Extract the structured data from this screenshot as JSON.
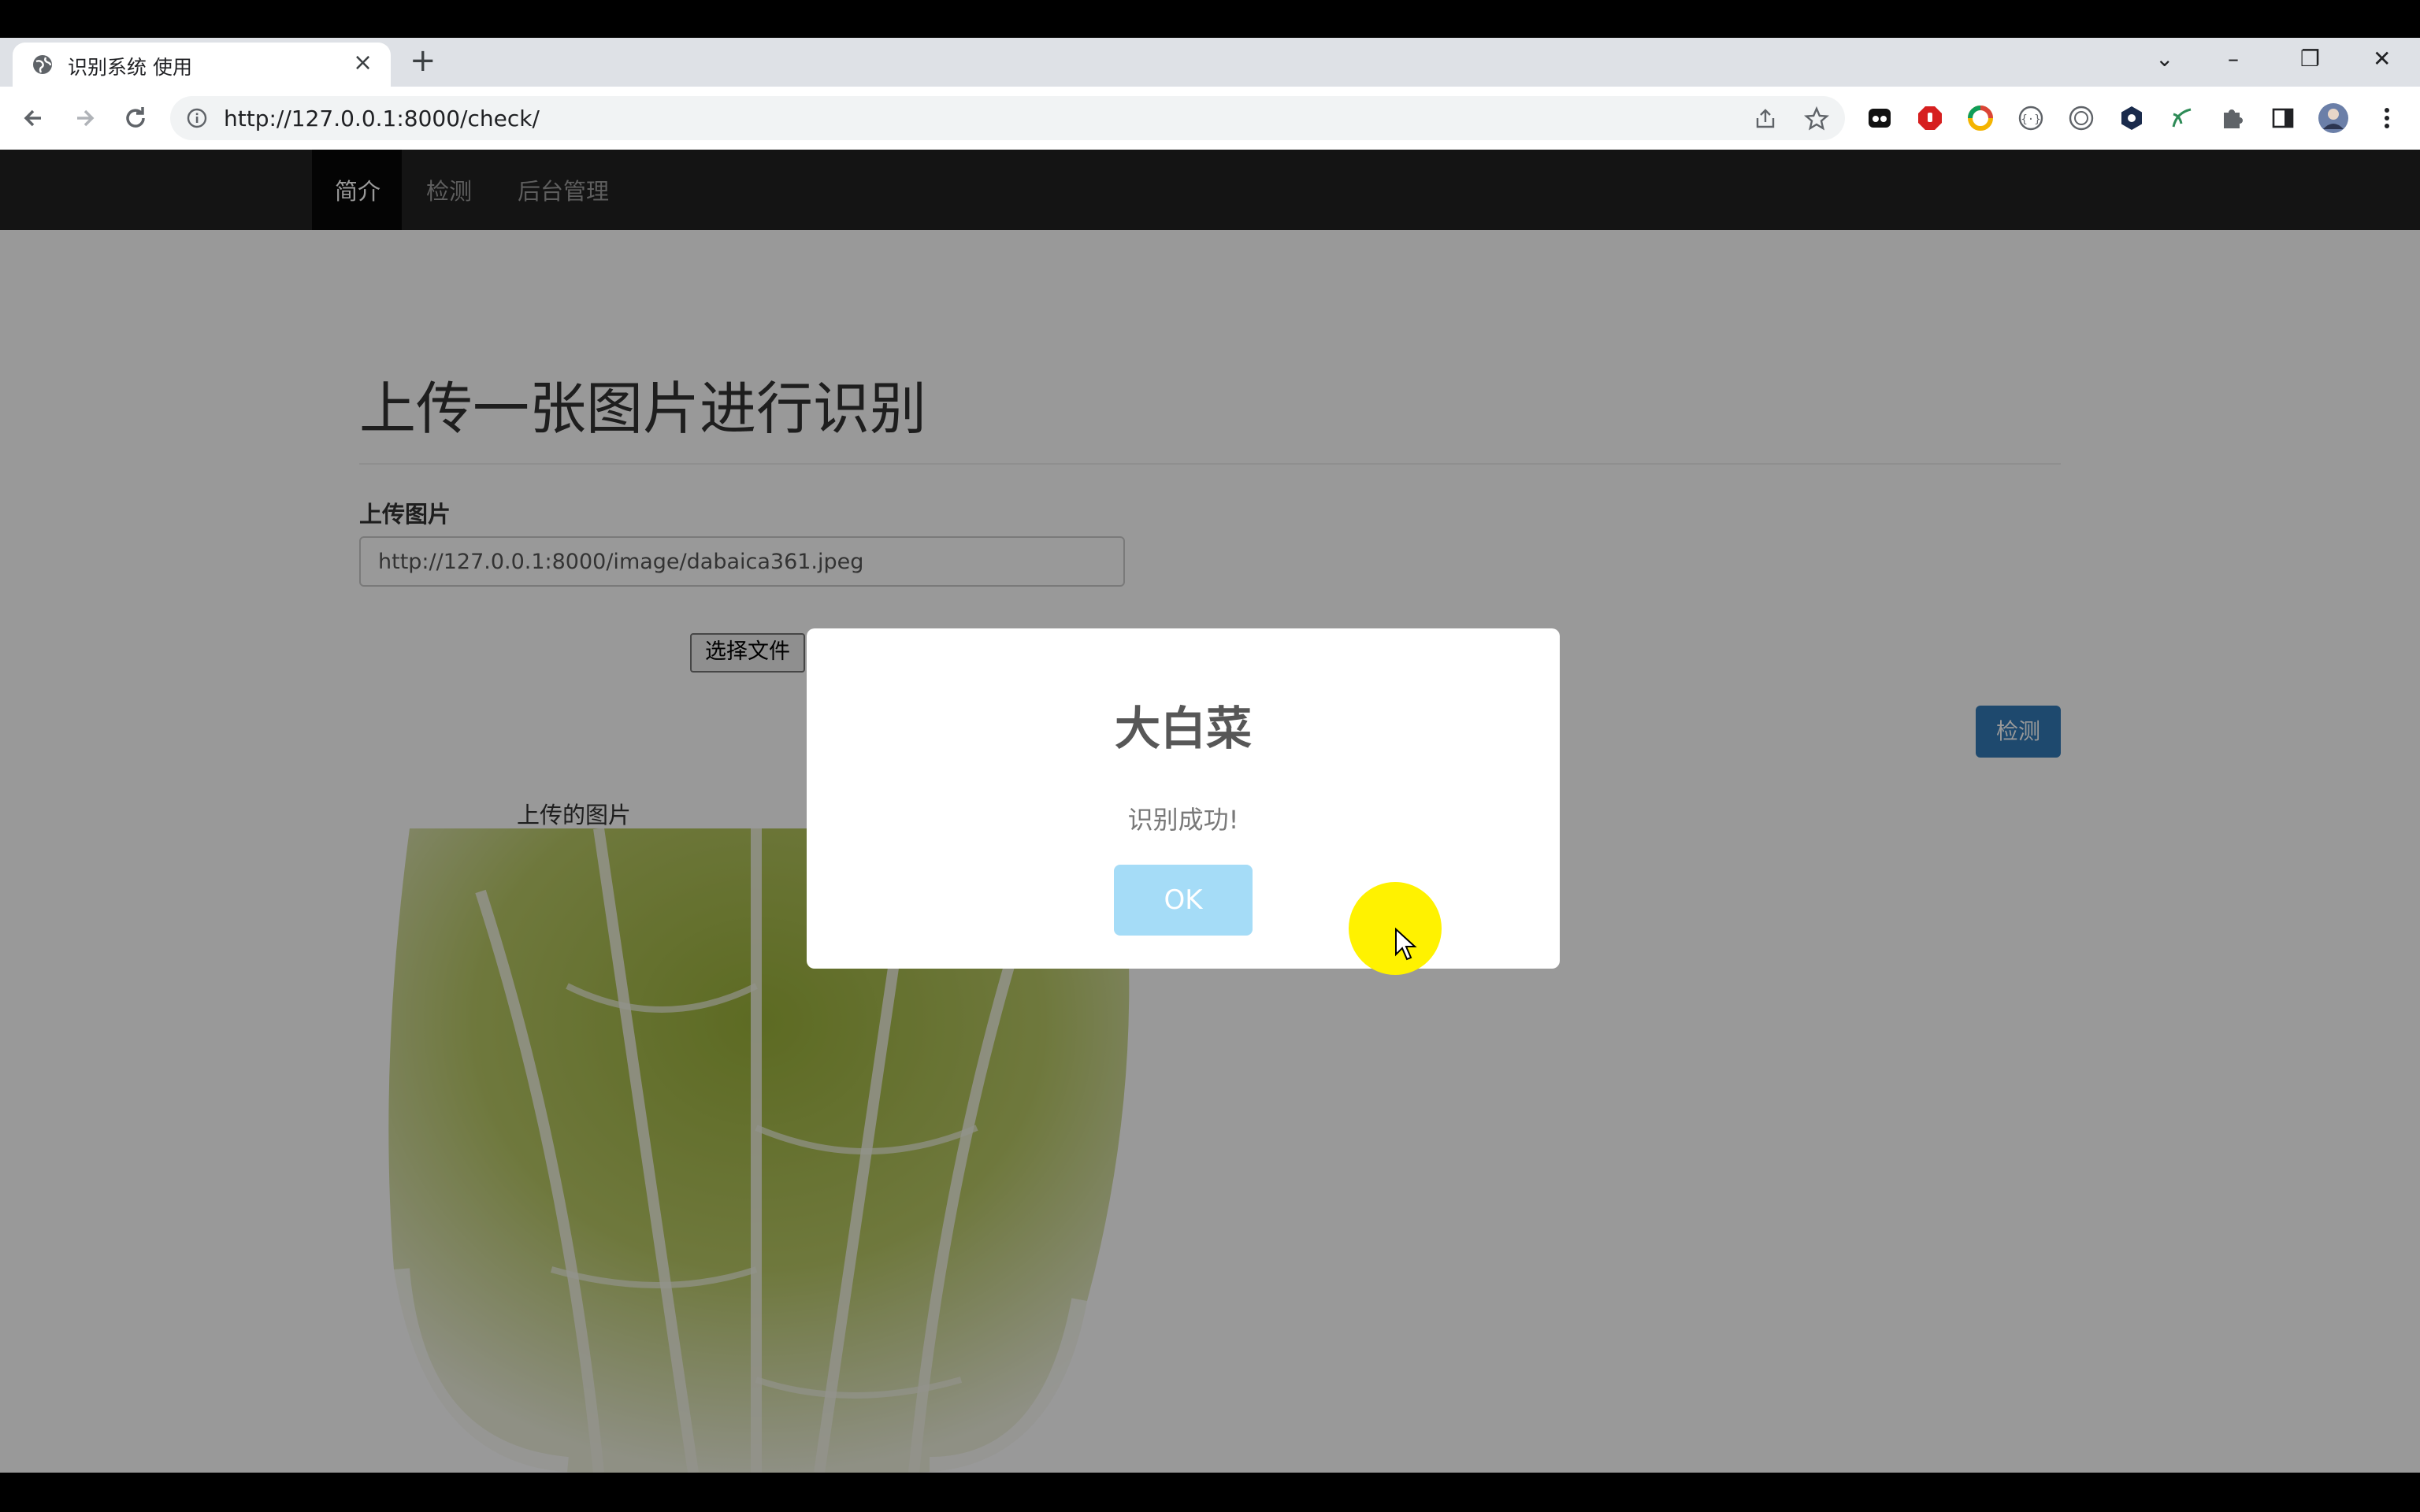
{
  "browser": {
    "tab_title": "识别系统 使用",
    "tab_close": "×",
    "new_tab": "+",
    "url": "http://127.0.0.1:8000/check/",
    "window_controls": {
      "chevron": "⌄",
      "minimize": "–",
      "restore": "❐",
      "close": "✕"
    },
    "icons": [
      "back-arrow-icon",
      "forward-arrow-icon",
      "reload-icon",
      "site-info-icon",
      "share-icon",
      "star-icon",
      "extensions-puzzle-icon",
      "side-panel-icon",
      "profile-avatar",
      "menu-dots-icon"
    ]
  },
  "navbar": {
    "items": [
      {
        "label": "简介",
        "active": true
      },
      {
        "label": "检测",
        "active": false
      },
      {
        "label": "后台管理",
        "active": false
      }
    ]
  },
  "main": {
    "heading": "上传一张图片进行识别",
    "upload_label": "上传图片",
    "image_url_value": "http://127.0.0.1:8000/image/dabaica361.jpeg",
    "choose_file_label": "选择文件",
    "detect_button": "检测",
    "uploaded_image_label": "上传的图片"
  },
  "dialog": {
    "title": "大白菜",
    "text": "识别成功!",
    "ok_label": "OK"
  },
  "colors": {
    "navbar_bg": "#222222",
    "primary_button": "#337ab7",
    "dialog_ok": "#a5dcf7",
    "cursor_highlight": "#fff200"
  }
}
